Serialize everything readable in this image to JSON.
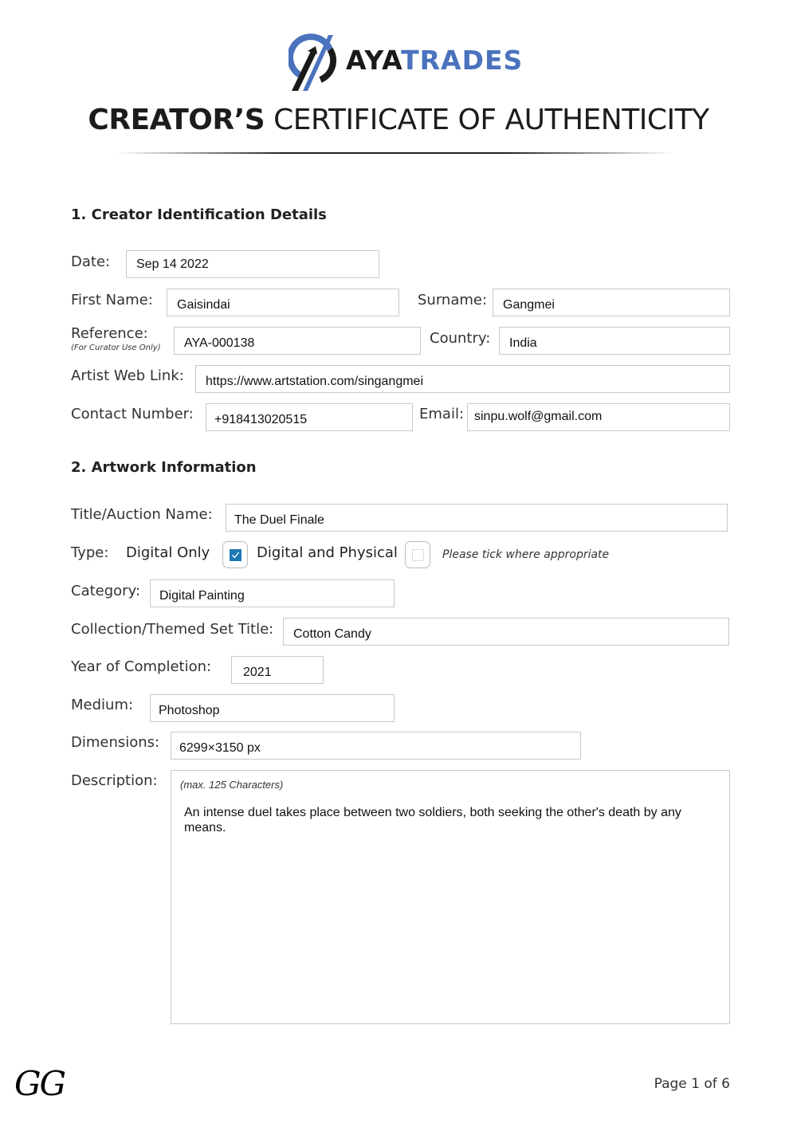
{
  "header": {
    "logo": {
      "icon": "ayatrades-logo-icon",
      "brand_part1": "AYA",
      "brand_part2": "TRADES",
      "brand_color": "#4a72bd"
    },
    "title_bold": "CREATOR’S",
    "title_light": "CERTIFICATE OF AUTHENTICITY"
  },
  "section1": {
    "heading": "1. Creator Identification Details",
    "date": {
      "label": "Date:",
      "value": "Sep 14 2022"
    },
    "first_name": {
      "label": "First Name:",
      "value": "Gaisindai"
    },
    "surname": {
      "label": "Surname:",
      "value": "Gangmei"
    },
    "reference": {
      "label": "Reference:",
      "sublabel": "(For Curator Use Only)",
      "value": "AYA-000138"
    },
    "country": {
      "label": "Country:",
      "value": "India"
    },
    "web_link": {
      "label": "Artist Web Link:",
      "value": "https://www.artstation.com/singangmei"
    },
    "contact": {
      "label": "Contact Number:",
      "value": "+918413020515"
    },
    "email": {
      "label": "Email:",
      "value": "sinpu.wolf@gmail.com"
    }
  },
  "section2": {
    "heading": "2. Artwork Information",
    "title": {
      "label": "Title/Auction Name:",
      "value": "The Duel Finale"
    },
    "type": {
      "label": "Type:",
      "options": [
        {
          "label": "Digital Only",
          "checked": true
        },
        {
          "label": "Digital and Physical",
          "checked": false
        }
      ],
      "hint": "Please tick where appropriate",
      "check_color": "#1e77b5"
    },
    "category": {
      "label": "Category:",
      "value": "Digital Painting"
    },
    "collection": {
      "label": "Collection/Themed Set Title:",
      "value": "Cotton Candy"
    },
    "year": {
      "label": "Year of Completion:",
      "value": "2021"
    },
    "medium": {
      "label": "Medium:",
      "value": "Photoshop"
    },
    "dimensions": {
      "label": "Dimensions:",
      "value": "6299×3150 px"
    },
    "description": {
      "label": "Description:",
      "hint": "(max. 125 Characters)",
      "value": "An intense duel takes place between two soldiers, both seeking the other's death by any means."
    }
  },
  "footer": {
    "initials": "GG",
    "page": "Page 1 of 6"
  }
}
